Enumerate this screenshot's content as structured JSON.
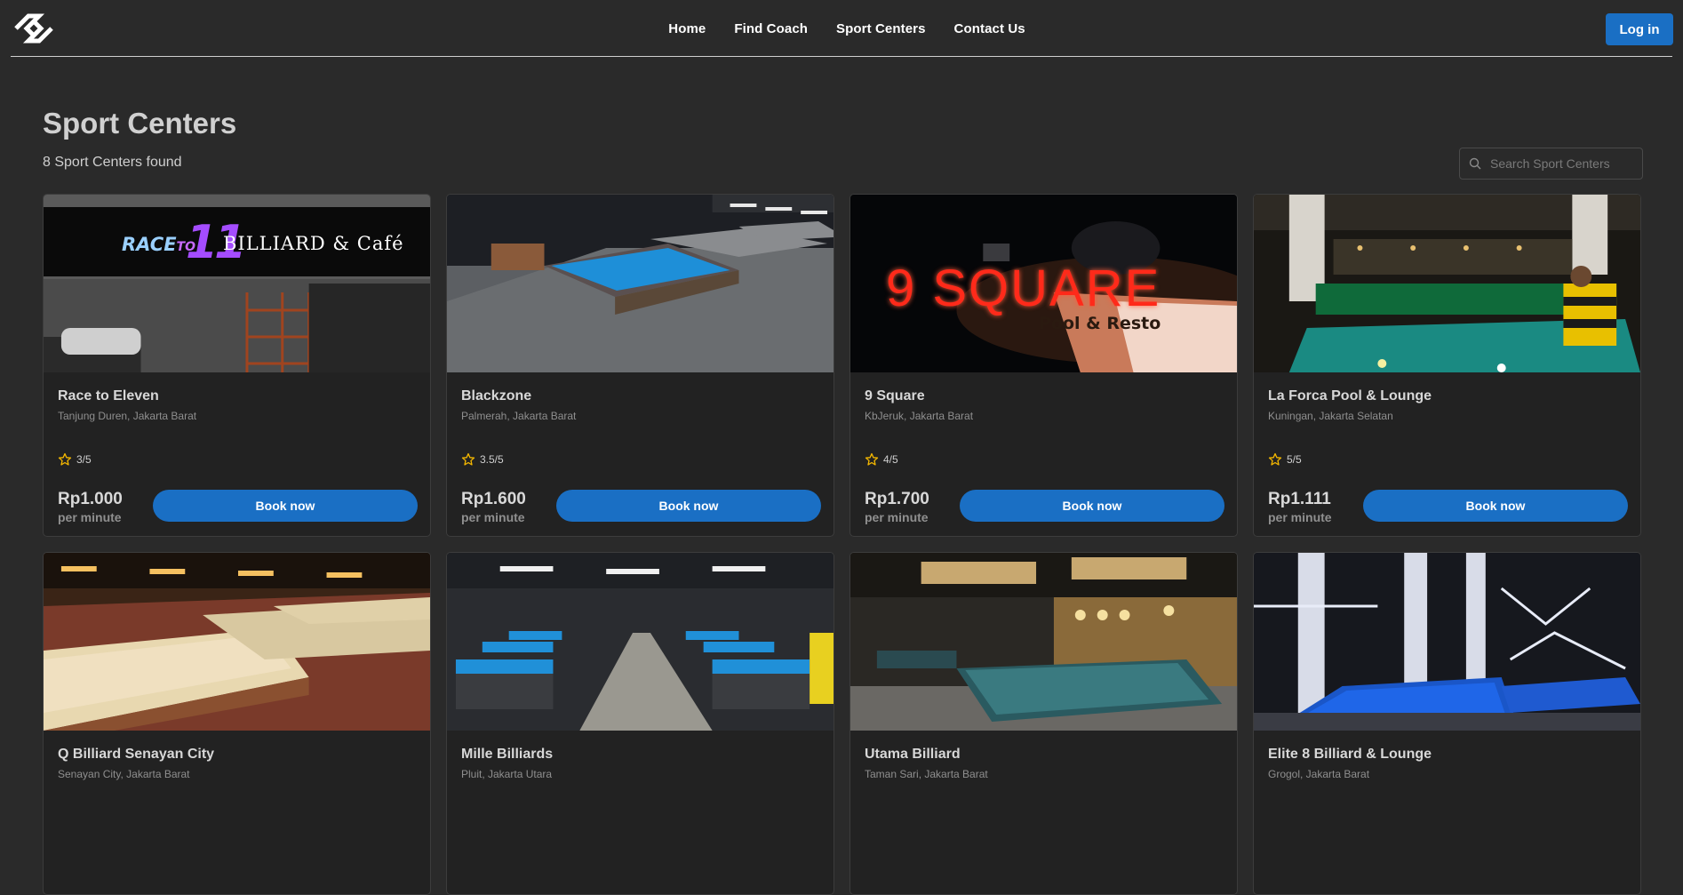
{
  "nav": {
    "links": [
      {
        "label": "Home"
      },
      {
        "label": "Find Coach"
      },
      {
        "label": "Sport Centers"
      },
      {
        "label": "Contact Us"
      }
    ],
    "login_label": "Log in"
  },
  "header": {
    "title": "Sport Centers",
    "count_text": "8 Sport Centers found"
  },
  "search": {
    "placeholder": "Search Sport Centers",
    "value": ""
  },
  "colors": {
    "accent": "#1a6fc4",
    "background": "#2a2a2a",
    "card": "#222222",
    "star": "#f5b800"
  },
  "centers": [
    {
      "name": "Race to Eleven",
      "location": "Tanjung Duren, Jakarta Barat",
      "rating": "3/5",
      "price": "Rp1.000",
      "unit": "per minute",
      "book_label": "Book now",
      "sign_text": "BILLIARD & Café",
      "sign_logo_a": "RACE",
      "sign_logo_b": "TO",
      "sign_logo_c": "11"
    },
    {
      "name": "Blackzone",
      "location": "Palmerah, Jakarta Barat",
      "rating": "3.5/5",
      "price": "Rp1.600",
      "unit": "per minute",
      "book_label": "Book now"
    },
    {
      "name": "9 Square",
      "location": "KbJeruk, Jakarta Barat",
      "rating": "4/5",
      "price": "Rp1.700",
      "unit": "per minute",
      "book_label": "Book now",
      "sign_text": "9 SQUARE",
      "sign_sub": "Pool & Resto"
    },
    {
      "name": "La Forca Pool & Lounge",
      "location": "Kuningan, Jakarta Selatan",
      "rating": "5/5",
      "price": "Rp1.111",
      "unit": "per minute",
      "book_label": "Book now"
    },
    {
      "name": "Q Billiard Senayan City",
      "location": "Senayan City, Jakarta Barat"
    },
    {
      "name": "Mille Billiards",
      "location": "Pluit, Jakarta Utara"
    },
    {
      "name": "Utama Billiard",
      "location": "Taman Sari, Jakarta Barat"
    },
    {
      "name": "Elite 8 Billiard & Lounge",
      "location": "Grogol, Jakarta Barat"
    }
  ]
}
